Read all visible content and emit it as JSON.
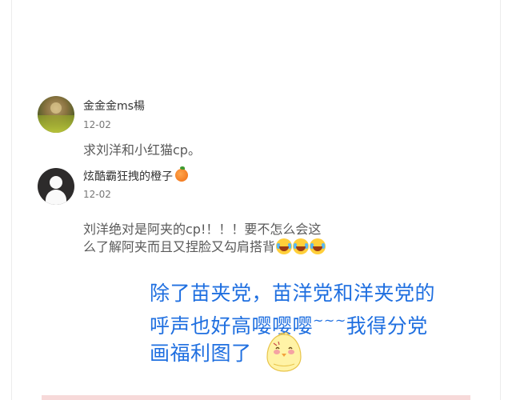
{
  "comments": [
    {
      "username": "金金金ms楊",
      "date": "12-02",
      "text": "求刘洋和小红猫cp。",
      "avatar_icon": "landscape-photo-avatar"
    },
    {
      "username": "炫酷霸狂拽的橙子",
      "username_icon": "orange-icon",
      "date": "12-02",
      "text_line1": "刘洋绝对是阿夹的cp!！！！要不怎么会这",
      "text_line2": "么了解阿夹而且又捏脸又勾肩搭背",
      "trailing_icons": [
        "laugh-cry-icon",
        "laugh-cry-icon",
        "laugh-cry-icon"
      ],
      "avatar_icon": "default-person-avatar"
    }
  ],
  "note": {
    "line1": "除了苗夹党，苗洋党和洋夹党的",
    "line2_a": "呼声也好高嘤嘤嘤",
    "line2_tilde": "~~~",
    "line2_b": "我得分党",
    "line3": "画福利图了",
    "color": "#1f6fe0",
    "sticker_icon": "chick-sticker-icon"
  },
  "colors": {
    "username": "#333333",
    "date": "#777777",
    "body": "#5a5a5a",
    "bottom_strip": "#f7d9d9"
  }
}
